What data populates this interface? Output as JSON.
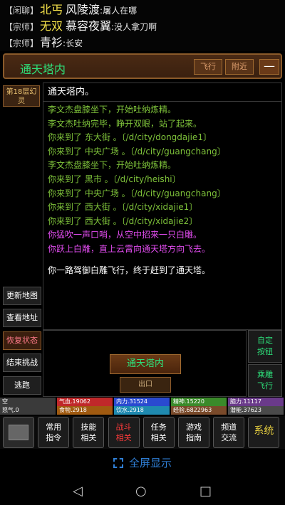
{
  "chat": [
    {
      "tag": "【闲聊】",
      "name1": "北丐",
      "name2": "风陵渡",
      "sep": ":",
      "msg": "屠人在哪"
    },
    {
      "tag": "【宗师】",
      "name1": "无双",
      "name2": "慕容夜翼",
      "sep": ":",
      "msg": "没人拿刀啊"
    },
    {
      "tag": "【宗师】",
      "name1": "",
      "name2": "青衫",
      "sep": ":",
      "msg": "长安"
    }
  ],
  "header": {
    "location": "通天塔内",
    "fly_label": "飞行",
    "nearby_label": "附近",
    "minimize_label": "—"
  },
  "left": {
    "floor": "第18层幻灵",
    "buttons": [
      "更新地图",
      "查看地址",
      "恢复状态",
      "结束挑战",
      "逃跑"
    ]
  },
  "log": {
    "title": "通天塔内。",
    "lines": [
      {
        "text": "李文杰盘膝坐下，开始吐纳炼精。",
        "color": "g"
      },
      {
        "text": "李文杰吐纳完毕，睁开双眼，站了起来。",
        "color": "g"
      },
      {
        "text": "你来到了 东大街 。〔/d/city/dongdajie1〕",
        "color": "g"
      },
      {
        "text": "你来到了 中央广场 。〔/d/city/guangchang〕",
        "color": "g"
      },
      {
        "text": "李文杰盘膝坐下，开始吐纳炼精。",
        "color": "g"
      },
      {
        "text": "你来到了 黑市 。〔/d/city/heishi〕",
        "color": "g"
      },
      {
        "text": "你来到了 中央广场 。〔/d/city/guangchang〕",
        "color": "g"
      },
      {
        "text": "你来到了 西大街 。〔/d/city/xidajie1〕",
        "color": "g"
      },
      {
        "text": "你来到了 西大街 。〔/d/city/xidajie2〕",
        "color": "g"
      },
      {
        "text": "你猛吹一声口哨，从空中招来一只白雕。",
        "color": "m"
      },
      {
        "text": "你跃上白雕，直上云霄向通天塔方向飞去。",
        "color": "m"
      },
      {
        "text": "",
        "color": "gap"
      },
      {
        "text": "你一路驾御白雕飞行，终于赶到了通天塔。",
        "color": "w"
      }
    ]
  },
  "action": {
    "place": "通天塔内",
    "sub": "出口",
    "right_buttons": [
      "自定按钮",
      "乘雕飞行"
    ]
  },
  "stats": {
    "row1": [
      {
        "label": "空",
        "color": "#3a3a3a"
      },
      {
        "label": "气血.19062",
        "color": "#c0282a"
      },
      {
        "label": "内力.31524",
        "color": "#2a4ad0"
      },
      {
        "label": "精神.15220",
        "color": "#3a8a2a"
      },
      {
        "label": "脑力.11117",
        "color": "#6a3a8a"
      }
    ],
    "row2": [
      {
        "label": "怒气.0",
        "color": "#3a3a3a"
      },
      {
        "label": "食物.2918",
        "color": "#a05a10"
      },
      {
        "label": "饮水.2918",
        "color": "#1f8ab0"
      },
      {
        "label": "经验.6822963",
        "color": "#7a4a2a"
      },
      {
        "label": "潜能.37623",
        "color": "#4a4a4a"
      }
    ]
  },
  "menu": [
    {
      "label": "",
      "type": "icon"
    },
    {
      "label": "常用指令",
      "type": "normal"
    },
    {
      "label": "技能相关",
      "type": "normal"
    },
    {
      "label": "战斗相关",
      "type": "red"
    },
    {
      "label": "任务相关",
      "type": "normal"
    },
    {
      "label": "游戏指南",
      "type": "normal"
    },
    {
      "label": "频道交流",
      "type": "normal"
    },
    {
      "label": "系统",
      "type": "gold"
    }
  ],
  "fullscreen": "全屏显示",
  "nav": {
    "back": "◁",
    "home": "○",
    "recent": "□"
  }
}
